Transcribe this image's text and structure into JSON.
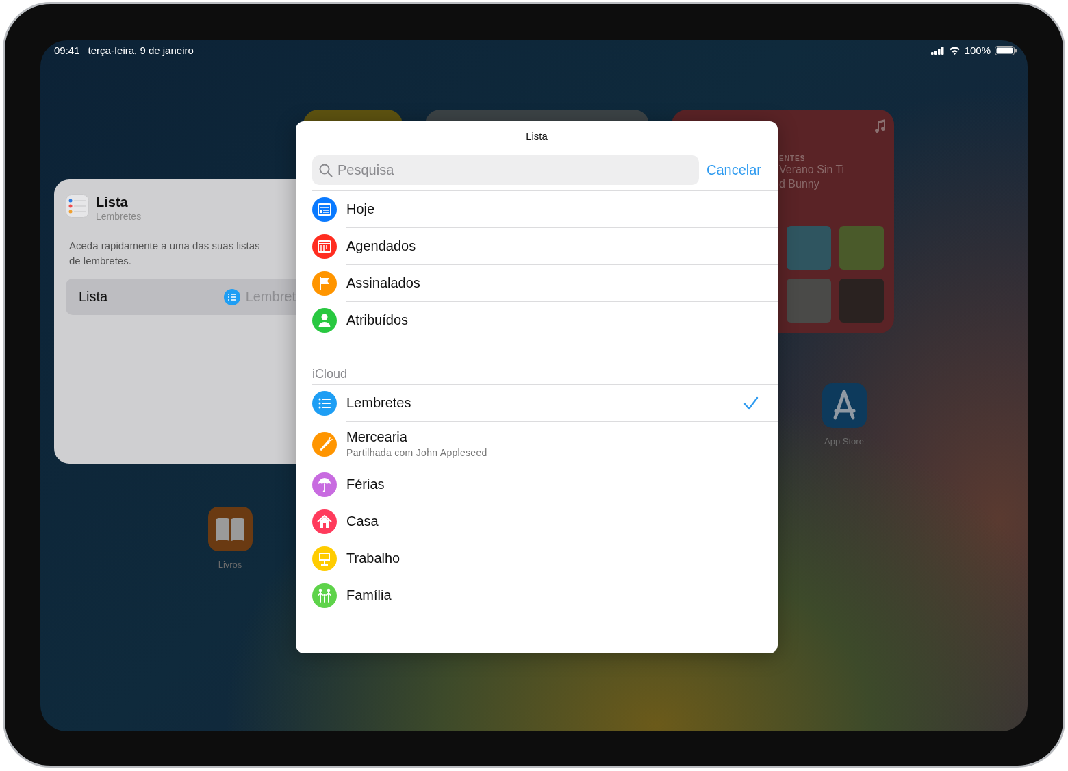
{
  "status_bar": {
    "time": "09:41",
    "date": "terça-feira, 9 de janeiro",
    "battery": "100%"
  },
  "background_widgets": {
    "reminders_widget": {
      "title": "Lista",
      "subtitle": "Lembretes",
      "description": "Aceda rapidamente a uma das suas listas de lembretes.",
      "option_label": "Lista",
      "option_value": "Lembret"
    },
    "music_widget": {
      "caption": "ENTES",
      "title": "Verano Sin Ti",
      "artist": "d Bunny"
    },
    "apps": [
      {
        "label": "App Store"
      },
      {
        "label": "Livros"
      }
    ]
  },
  "dialog": {
    "title": "Lista",
    "search": {
      "placeholder": "Pesquisa"
    },
    "cancel": "Cancelar",
    "smart_lists": [
      {
        "name": "Hoje",
        "color": "#0a7aff",
        "selected": false
      },
      {
        "name": "Agendados",
        "color": "#ff2d20",
        "selected": false
      },
      {
        "name": "Assinalados",
        "color": "#ff9500",
        "selected": false
      },
      {
        "name": "Atribuídos",
        "color": "#28c840",
        "selected": false
      }
    ],
    "section": "iCloud",
    "lists": [
      {
        "name": "Lembretes",
        "color": "#1e9ef4",
        "selected": true
      },
      {
        "name": "Mercearia",
        "subtitle": "Partilhada com John Appleseed",
        "color": "#ff9500",
        "selected": false
      },
      {
        "name": "Férias",
        "color": "#c86be0",
        "selected": false
      },
      {
        "name": "Casa",
        "color": "#ff3b5c",
        "selected": false
      },
      {
        "name": "Trabalho",
        "color": "#ffcc00",
        "selected": false
      },
      {
        "name": "Família",
        "color": "#5ed34a",
        "selected": false
      }
    ]
  }
}
